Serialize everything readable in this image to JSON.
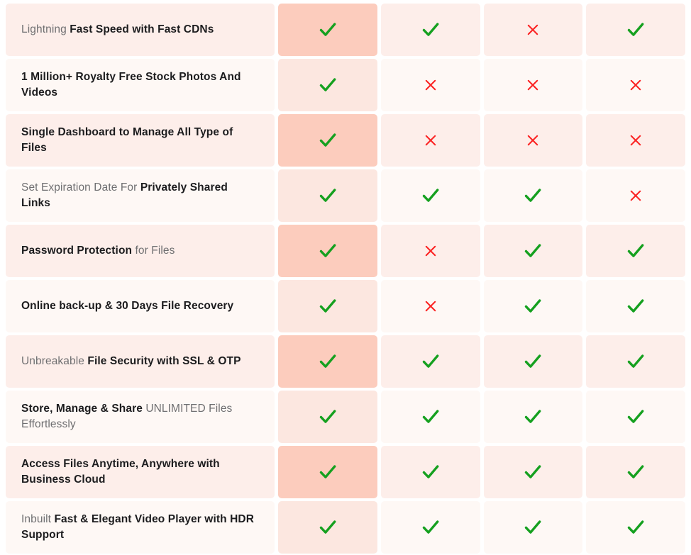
{
  "table": {
    "columns": [
      {
        "key": "col1",
        "highlight": true
      },
      {
        "key": "col2",
        "highlight": false
      },
      {
        "key": "col3",
        "highlight": false
      },
      {
        "key": "col4",
        "highlight": false
      }
    ],
    "icons": {
      "check": "check-icon",
      "cross": "cross-icon"
    },
    "colors": {
      "check": "#15a01f",
      "cross": "#fb2323",
      "row_tint_odd": "#fdeeea",
      "row_tint_even": "#fef8f5",
      "highlight_odd": "#fcccbd",
      "highlight_even": "#fce7e0",
      "text_regular": "#6f6f71",
      "text_bold": "#1c1c1e"
    },
    "rows": [
      {
        "feature": "Lightning Fast Speed with Fast CDNs",
        "segments": [
          {
            "text": "Lightning ",
            "bold": false
          },
          {
            "text": "Fast Speed with Fast CDNs",
            "bold": true
          }
        ],
        "marks": [
          "check",
          "check",
          "cross",
          "check"
        ]
      },
      {
        "feature": "1 Million+ Royalty Free Stock Photos And Videos",
        "segments": [
          {
            "text": "1 Million+ Royalty Free Stock Photos And Videos",
            "bold": true
          }
        ],
        "marks": [
          "check",
          "cross",
          "cross",
          "cross"
        ]
      },
      {
        "feature": "Single Dashboard to Manage All Type of Files",
        "segments": [
          {
            "text": "Single Dashboard to Manage All Type of Files",
            "bold": true
          }
        ],
        "marks": [
          "check",
          "cross",
          "cross",
          "cross"
        ]
      },
      {
        "feature": "Set Expiration Date For Privately Shared Links",
        "segments": [
          {
            "text": "Set Expiration Date For ",
            "bold": false
          },
          {
            "text": "Privately Shared Links",
            "bold": true
          }
        ],
        "marks": [
          "check",
          "check",
          "check",
          "cross"
        ]
      },
      {
        "feature": "Password Protection for Files",
        "segments": [
          {
            "text": "Password Protection",
            "bold": true
          },
          {
            "text": " for Files",
            "bold": false
          }
        ],
        "marks": [
          "check",
          "cross",
          "check",
          "check"
        ]
      },
      {
        "feature": "Online back-up & 30 Days File Recovery",
        "segments": [
          {
            "text": "Online back-up & 30 Days File Recovery",
            "bold": true
          }
        ],
        "marks": [
          "check",
          "cross",
          "check",
          "check"
        ]
      },
      {
        "feature": "Unbreakable File Security with SSL & OTP",
        "segments": [
          {
            "text": "Unbreakable ",
            "bold": false
          },
          {
            "text": "File Security with SSL & OTP",
            "bold": true
          }
        ],
        "marks": [
          "check",
          "check",
          "check",
          "check"
        ]
      },
      {
        "feature": "Store, Manage & Share UNLIMITED Files Effortlessly",
        "segments": [
          {
            "text": "Store, Manage & Share",
            "bold": true
          },
          {
            "text": " UNLIMITED Files Effortlessly",
            "bold": false
          }
        ],
        "marks": [
          "check",
          "check",
          "check",
          "check"
        ]
      },
      {
        "feature": "Access Files Anytime, Anywhere with Business Cloud",
        "segments": [
          {
            "text": "Access Files Anytime, Anywhere with Business Cloud",
            "bold": true
          }
        ],
        "marks": [
          "check",
          "check",
          "check",
          "check"
        ]
      },
      {
        "feature": "Inbuilt Fast & Elegant Video Player with HDR Support",
        "segments": [
          {
            "text": "Inbuilt ",
            "bold": false
          },
          {
            "text": "Fast & Elegant Video Player with HDR Support",
            "bold": true
          }
        ],
        "marks": [
          "check",
          "check",
          "check",
          "check"
        ]
      }
    ]
  }
}
